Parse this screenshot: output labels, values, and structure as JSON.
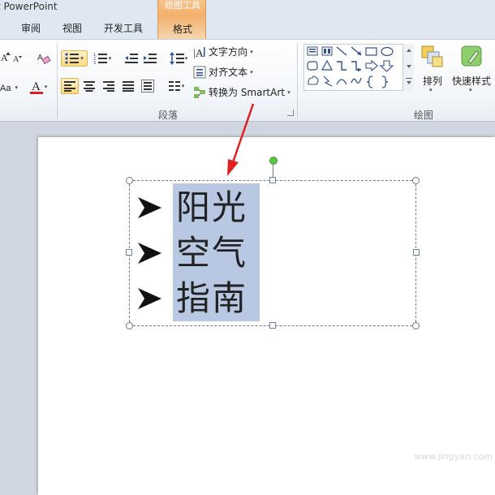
{
  "window": {
    "title": "t PowerPoint"
  },
  "tabs": [
    {
      "label": "审阅"
    },
    {
      "label": "视图"
    },
    {
      "label": "开发工具"
    }
  ],
  "context_tab": {
    "group_label": "绘图工具",
    "tab_label": "格式"
  },
  "paragraph_group": {
    "label": "段落",
    "text_direction": "文字方向",
    "align_text": "对齐文本",
    "convert_smartart": "转换为 SmartArt"
  },
  "drawing_group": {
    "label": "绘图",
    "arrange": "排列",
    "quick_styles": "快速样式"
  },
  "slide": {
    "bullets": [
      {
        "text": "阳光"
      },
      {
        "text": "空气"
      },
      {
        "text": "指南"
      }
    ]
  },
  "colors": {
    "accent": "#f3b06b",
    "selection": "#b8c8e2",
    "annotation": "#e02020",
    "font_color_bar": "#e02020"
  },
  "watermark": "www.jingyan.com"
}
